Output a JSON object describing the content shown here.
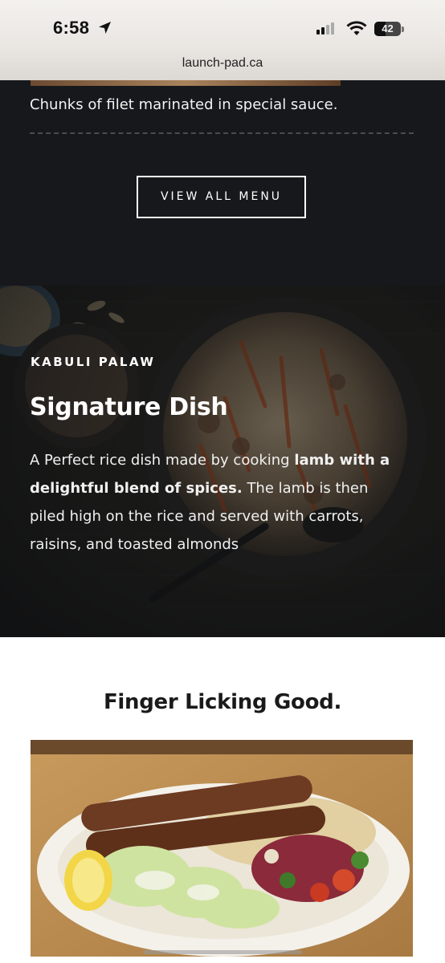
{
  "status_bar": {
    "time": "6:58",
    "battery": "42",
    "url": "launch-pad.ca"
  },
  "menu": {
    "last_item_description": "Chunks of filet marinated in special sauce.",
    "view_all_label": "VIEW ALL MENU"
  },
  "signature": {
    "kicker": "KABULI PALAW",
    "title": "Signature Dish",
    "body_part1": "A Perfect rice dish made by cooking ",
    "body_bold": "lamb with a delightful blend of spices.",
    "body_part2": " The lamb is then piled high on the rice and served with carrots, raisins, and toasted almonds"
  },
  "finger_licking": {
    "title": "Finger Licking Good."
  }
}
